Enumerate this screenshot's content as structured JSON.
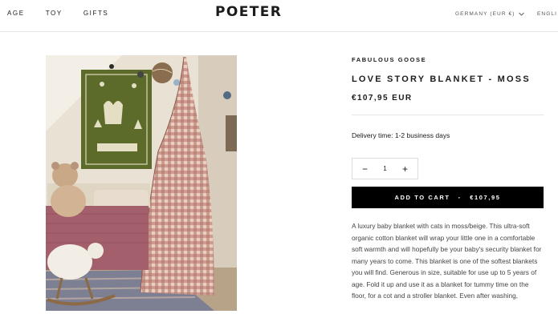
{
  "header": {
    "nav": [
      "AGE",
      "TOY",
      "GIFTS"
    ],
    "logo": "POETER",
    "country": "GERMANY (EUR €)",
    "language": "ENGLI"
  },
  "product": {
    "vendor": "FABULOUS GOOSE",
    "title": "LOVE STORY BLANKET - MOSS",
    "price": "€107,95 EUR",
    "delivery": "Delivery time: 1-2 business days",
    "quantity": "1",
    "add_to_cart": "ADD TO CART",
    "cart_price": "€107,95",
    "description": "A luxury baby blanket with cats in moss/beige. This ultra-soft organic cotton blanket will wrap your little one in a comfortable soft warmth and will hopefully be your baby's security blanket for many years to come. This blanket is one of the softest blankets you will find. Generous in size, suitable for use up to 5 years of age. Fold it up and use it as a blanket for tummy time on the floor, for a cot and a stroller blanket. Even after washing,"
  },
  "icons": {
    "country_chevron": "chevron-down-icon",
    "qty_minus": "minus-icon",
    "qty_plus": "plus-icon"
  },
  "colors": {
    "accent": "#000000",
    "text": "#1c1b1b",
    "blanket_green": "#5d6b2a",
    "gingham": "#a0685a"
  }
}
